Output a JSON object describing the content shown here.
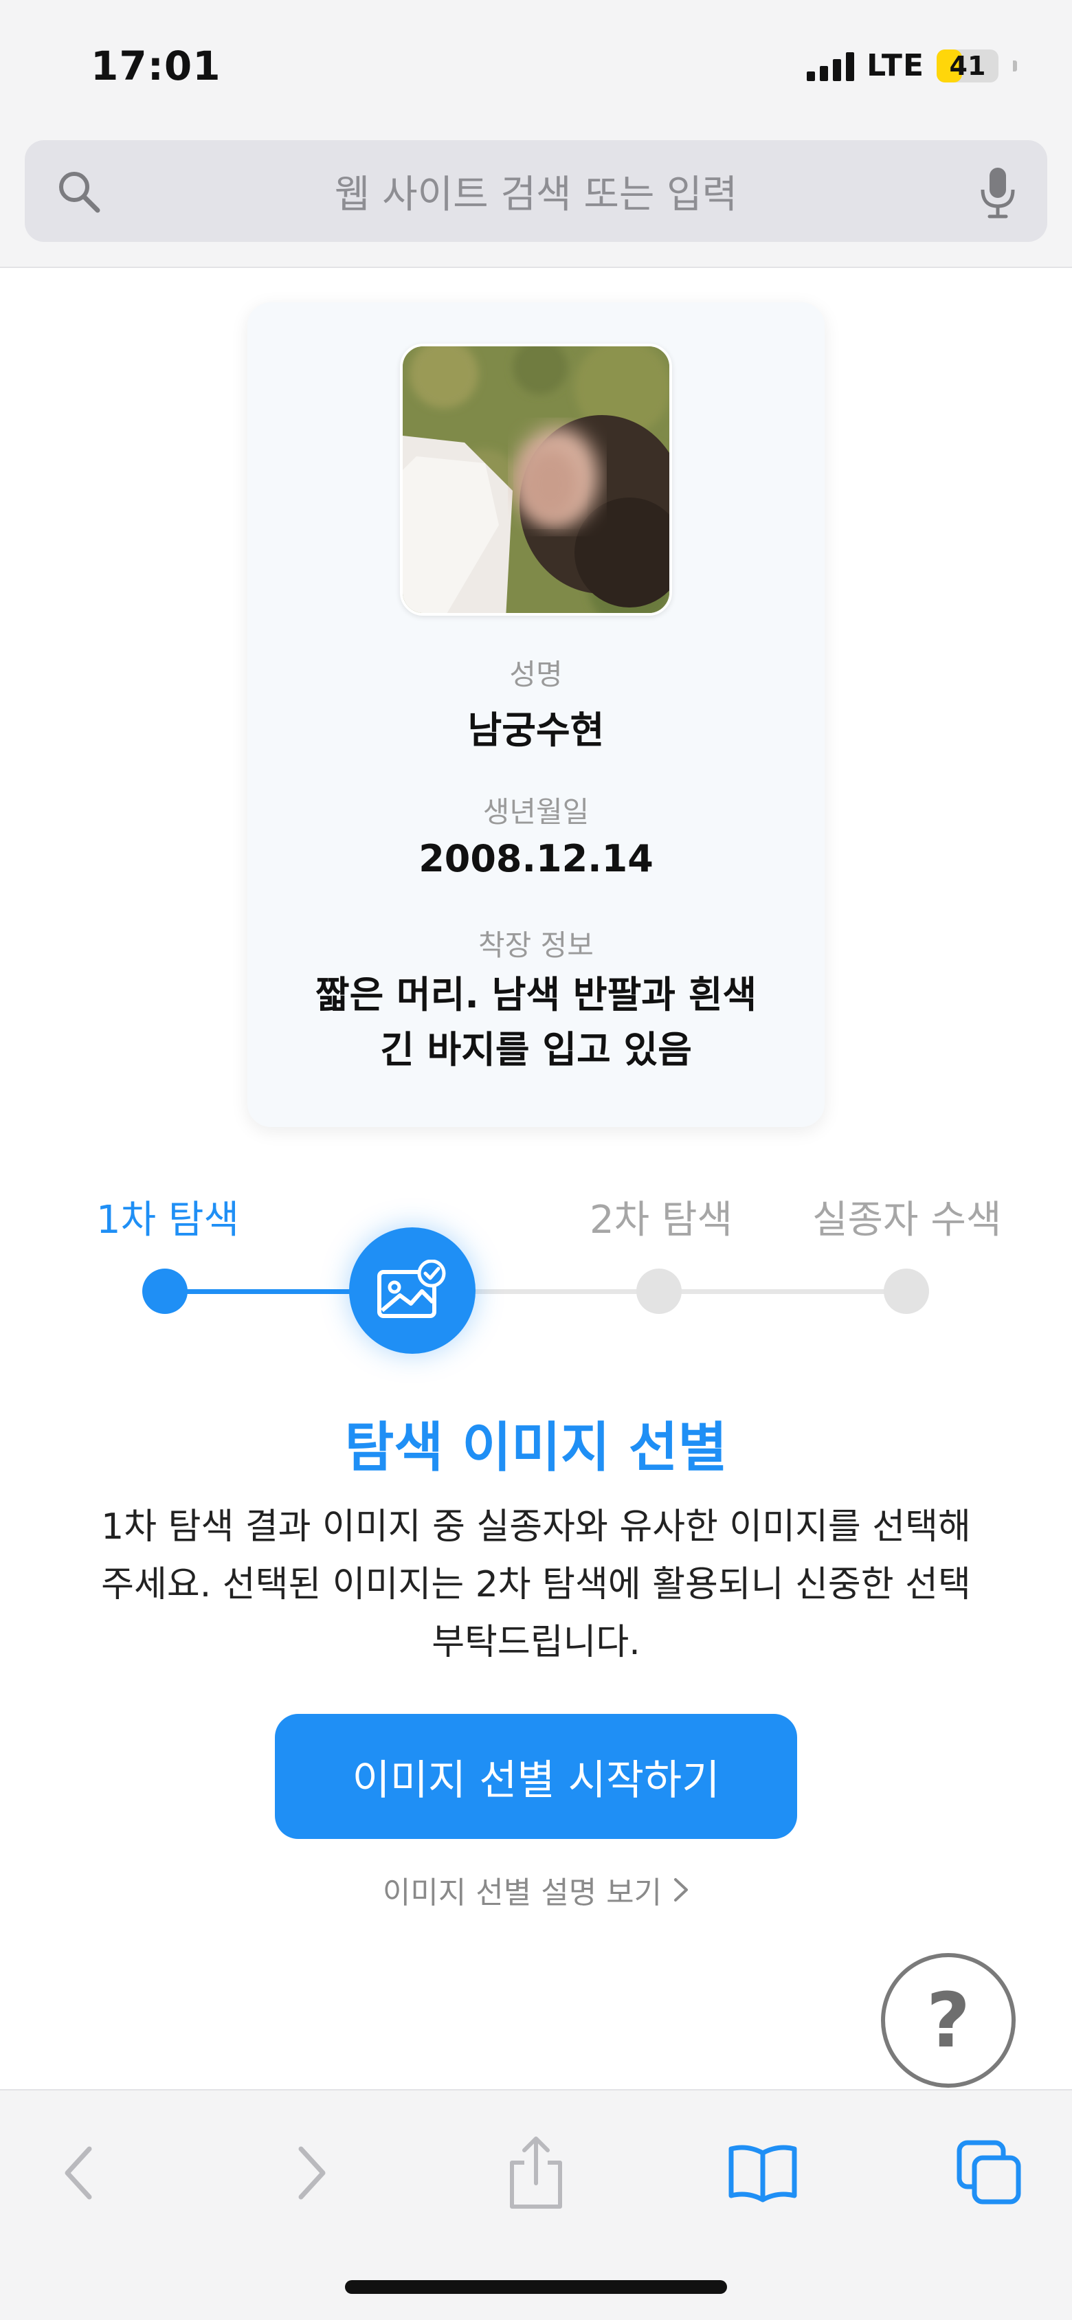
{
  "status_bar": {
    "time": "17:01",
    "network": "LTE",
    "battery": "41",
    "battery_level_percent": 41,
    "battery_color": "#ffd60a"
  },
  "address_bar": {
    "placeholder": "웹 사이트 검색 또는 입력",
    "icons": [
      "search-icon",
      "microphone-icon"
    ]
  },
  "profile": {
    "name_label": "성명",
    "name": "남궁수현",
    "birth_label": "생년월일",
    "birth": "2008.12.14",
    "clothing_label": "착장 정보",
    "clothing": "짧은 머리. 남색 반팔과 흰색 긴 바지를 입고 있음"
  },
  "steps": [
    {
      "label": "1차 탐색",
      "state": "active"
    },
    {
      "label": "",
      "state": "current",
      "icon": "image-check-icon"
    },
    {
      "label": "2차 탐색",
      "state": "inactive"
    },
    {
      "label": "실종자 수색",
      "state": "inactive"
    }
  ],
  "main": {
    "title": "탐색 이미지 선별",
    "description": "1차 탐색 결과 이미지 중 실종자와 유사한 이미지를 선택해주세요. 선택된 이미지는 2차 탐색에 활용되니 신중한 선택 부탁드립니다.",
    "primary_button": "이미지 선별 시작하기",
    "help_link": "이미지 선별 설명 보기",
    "help_fab": "?"
  },
  "toolbar": {
    "items": [
      "back-icon",
      "forward-icon",
      "share-icon",
      "bookmarks-icon",
      "tabs-icon"
    ]
  },
  "colors": {
    "accent": "#1f8ff5",
    "inactive": "#a6a6a6",
    "card_bg": "#f6f9fc"
  }
}
